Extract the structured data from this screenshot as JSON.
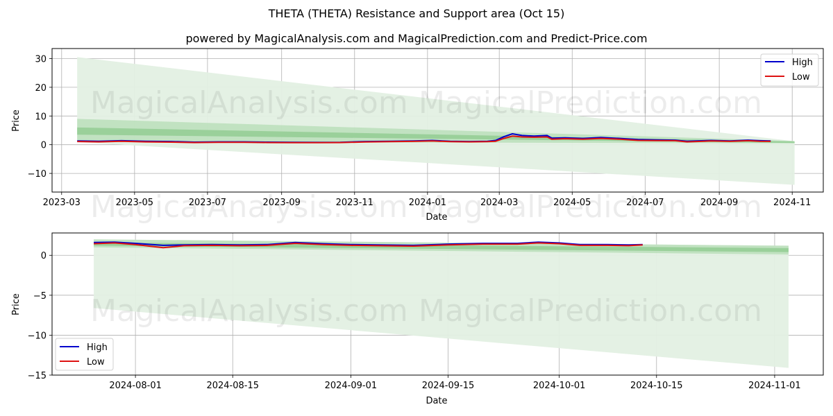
{
  "header": {
    "title": "THETA (THETA) Resistance and Support area (Oct 15)",
    "subtitle": "powered by MagicalAnalysis.com and MagicalPrediction.com and Predict-Price.com"
  },
  "watermarks": [
    "MagicalAnalysis.com",
    "MagicalPrediction.com"
  ],
  "colors": {
    "high": "#0000cc",
    "low": "#dd1111",
    "band_light": "#e3f0e3",
    "band_mid": "#b5dcb5",
    "band_dark": "#8cc98c",
    "grid": "#b0b0b0"
  },
  "chart_data": [
    {
      "type": "line",
      "title": "",
      "xlabel": "Date",
      "ylabel": "Price",
      "ylim": [
        -16.5,
        33.5
      ],
      "xlim": [
        "2023-02-21",
        "2024-11-27"
      ],
      "grid": true,
      "legend": {
        "position": "top-right",
        "entries": [
          "High",
          "Low"
        ]
      },
      "x_ticks": [
        "2023-03",
        "2023-05",
        "2023-07",
        "2023-09",
        "2023-11",
        "2024-01",
        "2024-03",
        "2024-05",
        "2024-07",
        "2024-09",
        "2024-11"
      ],
      "x_tick_dates": [
        "2023-03-01",
        "2023-05-01",
        "2023-07-01",
        "2023-09-01",
        "2023-11-01",
        "2024-01-01",
        "2024-03-01",
        "2024-05-01",
        "2024-07-01",
        "2024-09-01",
        "2024-11-01"
      ],
      "y_ticks": [
        30,
        20,
        10,
        0,
        -10
      ],
      "bands": [
        {
          "name": "outer-band",
          "x": [
            "2023-03-14",
            "2024-11-03"
          ],
          "upper": [
            30.5,
            1.2
          ],
          "lower": [
            0.9,
            -14.0
          ]
        },
        {
          "name": "mid-band",
          "x": [
            "2023-03-14",
            "2024-11-03"
          ],
          "upper": [
            9.0,
            1.3
          ],
          "lower": [
            1.0,
            0.5
          ]
        },
        {
          "name": "inner-band",
          "x": [
            "2023-03-14",
            "2024-11-03"
          ],
          "upper": [
            6.0,
            1.1
          ],
          "lower": [
            3.5,
            0.6
          ]
        }
      ],
      "series": [
        {
          "name": "High",
          "x": [
            "2023-03-14",
            "2023-04-01",
            "2023-04-20",
            "2023-05-10",
            "2023-06-01",
            "2023-06-20",
            "2023-07-10",
            "2023-08-01",
            "2023-08-20",
            "2023-09-10",
            "2023-10-01",
            "2023-10-20",
            "2023-11-10",
            "2023-12-01",
            "2023-12-20",
            "2024-01-05",
            "2024-01-20",
            "2024-02-05",
            "2024-02-20",
            "2024-02-27",
            "2024-03-05",
            "2024-03-12",
            "2024-03-20",
            "2024-03-30",
            "2024-04-10",
            "2024-04-14",
            "2024-04-25",
            "2024-05-10",
            "2024-05-25",
            "2024-06-10",
            "2024-06-25",
            "2024-07-10",
            "2024-07-26",
            "2024-08-05",
            "2024-08-25",
            "2024-09-10",
            "2024-09-25",
            "2024-10-05",
            "2024-10-14"
          ],
          "values": [
            1.3,
            1.2,
            1.4,
            1.2,
            1.1,
            0.9,
            1.0,
            1.0,
            0.9,
            0.85,
            0.8,
            0.85,
            1.1,
            1.2,
            1.3,
            1.5,
            1.2,
            1.1,
            1.2,
            1.5,
            2.8,
            3.8,
            3.2,
            3.0,
            3.2,
            2.3,
            2.4,
            2.2,
            2.5,
            2.2,
            1.8,
            1.7,
            1.6,
            1.2,
            1.5,
            1.3,
            1.6,
            1.4,
            1.3
          ]
        },
        {
          "name": "Low",
          "x": [
            "2023-03-14",
            "2023-04-01",
            "2023-04-20",
            "2023-05-10",
            "2023-06-01",
            "2023-06-20",
            "2023-07-10",
            "2023-08-01",
            "2023-08-20",
            "2023-09-10",
            "2023-10-01",
            "2023-10-20",
            "2023-11-10",
            "2023-12-01",
            "2023-12-20",
            "2024-01-05",
            "2024-01-20",
            "2024-02-05",
            "2024-02-20",
            "2024-02-27",
            "2024-03-05",
            "2024-03-12",
            "2024-03-20",
            "2024-03-30",
            "2024-04-10",
            "2024-04-14",
            "2024-04-25",
            "2024-05-10",
            "2024-05-25",
            "2024-06-10",
            "2024-06-25",
            "2024-07-10",
            "2024-07-26",
            "2024-08-05",
            "2024-08-25",
            "2024-09-10",
            "2024-09-25",
            "2024-10-05",
            "2024-10-14"
          ],
          "values": [
            1.1,
            1.0,
            1.2,
            1.0,
            0.9,
            0.75,
            0.85,
            0.85,
            0.75,
            0.7,
            0.7,
            0.75,
            0.95,
            1.05,
            1.15,
            1.3,
            1.05,
            1.0,
            1.05,
            1.2,
            2.2,
            3.0,
            2.7,
            2.6,
            2.7,
            1.9,
            2.1,
            1.9,
            2.2,
            1.9,
            1.5,
            1.45,
            1.4,
            1.0,
            1.3,
            1.15,
            1.4,
            1.2,
            1.15
          ]
        }
      ]
    },
    {
      "type": "line",
      "title": "",
      "xlabel": "Date",
      "ylabel": "Price",
      "ylim": [
        -15,
        2.8
      ],
      "xlim": [
        "2024-07-20",
        "2024-11-08"
      ],
      "grid": true,
      "legend": {
        "position": "bottom-left",
        "entries": [
          "High",
          "Low"
        ]
      },
      "x_ticks": [
        "2024-08-01",
        "2024-08-15",
        "2024-09-01",
        "2024-09-15",
        "2024-10-01",
        "2024-10-15",
        "2024-11-01"
      ],
      "x_tick_dates": [
        "2024-08-01",
        "2024-08-15",
        "2024-09-01",
        "2024-09-15",
        "2024-10-01",
        "2024-10-15",
        "2024-11-01"
      ],
      "y_ticks": [
        0,
        -5,
        -10,
        -15
      ],
      "bands": [
        {
          "name": "outer-band",
          "x": [
            "2024-07-26",
            "2024-11-03"
          ],
          "upper": [
            2.0,
            1.2
          ],
          "lower": [
            -6.6,
            -14.1
          ]
        },
        {
          "name": "mid-band",
          "x": [
            "2024-07-26",
            "2024-11-03"
          ],
          "upper": [
            2.0,
            1.2
          ],
          "lower": [
            1.0,
            0.1
          ]
        },
        {
          "name": "inner-band",
          "x": [
            "2024-07-26",
            "2024-11-03"
          ],
          "upper": [
            1.6,
            0.9
          ],
          "lower": [
            1.2,
            0.4
          ]
        }
      ],
      "series": [
        {
          "name": "High",
          "x": [
            "2024-07-26",
            "2024-07-29",
            "2024-08-01",
            "2024-08-05",
            "2024-08-08",
            "2024-08-12",
            "2024-08-16",
            "2024-08-20",
            "2024-08-24",
            "2024-08-28",
            "2024-09-01",
            "2024-09-05",
            "2024-09-10",
            "2024-09-15",
            "2024-09-20",
            "2024-09-25",
            "2024-09-28",
            "2024-10-01",
            "2024-10-04",
            "2024-10-08",
            "2024-10-11",
            "2024-10-13"
          ],
          "values": [
            1.6,
            1.65,
            1.5,
            1.25,
            1.3,
            1.35,
            1.3,
            1.35,
            1.6,
            1.45,
            1.35,
            1.3,
            1.25,
            1.4,
            1.5,
            1.5,
            1.65,
            1.55,
            1.35,
            1.35,
            1.3,
            1.35
          ]
        },
        {
          "name": "Low",
          "x": [
            "2024-07-26",
            "2024-07-29",
            "2024-08-01",
            "2024-08-05",
            "2024-08-08",
            "2024-08-12",
            "2024-08-16",
            "2024-08-20",
            "2024-08-24",
            "2024-08-28",
            "2024-09-01",
            "2024-09-05",
            "2024-09-10",
            "2024-09-15",
            "2024-09-20",
            "2024-09-25",
            "2024-09-28",
            "2024-10-01",
            "2024-10-04",
            "2024-10-08",
            "2024-10-11",
            "2024-10-13"
          ],
          "values": [
            1.45,
            1.55,
            1.35,
            0.95,
            1.2,
            1.25,
            1.2,
            1.25,
            1.5,
            1.35,
            1.25,
            1.2,
            1.15,
            1.3,
            1.4,
            1.4,
            1.55,
            1.45,
            1.25,
            1.25,
            1.2,
            1.3
          ]
        }
      ]
    }
  ]
}
